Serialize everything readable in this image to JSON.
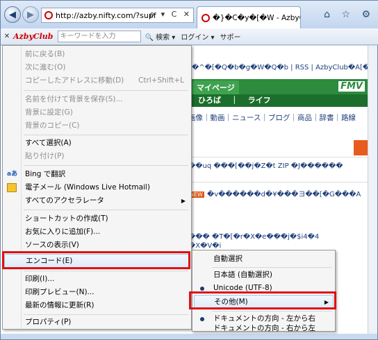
{
  "browser": {
    "url": "http://azby.nifty.com/?supf",
    "url_controls": "ρ ▾ C ✕",
    "tab_title": "�}�C�y�[�W - AzbyClub...",
    "tab_close": "✕",
    "window_controls": "⌂ ☆ ⚙",
    "back": "◀",
    "forward": "▶"
  },
  "toolbar": {
    "close": "✕",
    "brand": "AzbyClub",
    "search_placeholder": "キーワードを入力",
    "search_button": "🔍 検索 ▾",
    "login": "ログイン ▾",
    "support": "サポー"
  },
  "page": {
    "links": "�^�[�Q�b�g�W�Q�b | RSS | AzbyClub�Ȃ[�",
    "mypage_tab": "マイページ",
    "fmv": "FMV",
    "subnav": "ひろば ｜ ライフ",
    "categories": "画像｜動画｜ニュース｜ブログ｜商品｜辞書｜路線",
    "row1": "��uq ���[��j�Z�t ZIP �J������",
    "new_badge": "NEW",
    "row2": "�v������d�¥���ヨ��[�G���A",
    "row3": "��� �T�[�r�X�e���j�$i4�4",
    "row4": "�X�V�i"
  },
  "context_menu": {
    "items": [
      {
        "label": "前に戻る(B)",
        "disabled": true
      },
      {
        "label": "次に進む(O)",
        "disabled": true
      },
      {
        "label": "コピーしたアドレスに移動(D)",
        "shortcut": "Ctrl+Shift+L",
        "disabled": true
      },
      {
        "label": "名前を付けて背景を保存(S)...",
        "disabled": true
      },
      {
        "label": "背景に設定(G)",
        "disabled": true
      },
      {
        "label": "背景のコピー(C)",
        "disabled": true
      },
      {
        "label": "すべて選択(A)",
        "disabled": false
      },
      {
        "label": "貼り付け(P)",
        "disabled": true
      },
      {
        "label": "Bing で翻訳",
        "disabled": false,
        "icon": "translate-icon"
      },
      {
        "label": "電子メール (Windows Live Hotmail)",
        "disabled": false,
        "icon": "email-icon"
      },
      {
        "label": "すべてのアクセラレータ",
        "disabled": false,
        "submenu": true
      },
      {
        "label": "ショートカットの作成(T)",
        "disabled": false
      },
      {
        "label": "お気に入りに追加(F)...",
        "disabled": false
      },
      {
        "label": "ソースの表示(V)",
        "disabled": false
      },
      {
        "label": "エンコード(E)",
        "disabled": false,
        "highlighted": true
      },
      {
        "label": "印刷(I)...",
        "disabled": false
      },
      {
        "label": "印刷プレビュー(N)...",
        "disabled": false
      },
      {
        "label": "最新の情報に更新(R)",
        "disabled": false
      },
      {
        "label": "プロパティ(P)",
        "disabled": false
      }
    ],
    "submenu_arrow": "▶"
  },
  "encode_submenu": {
    "items": [
      {
        "label": "自動選択",
        "checked": false
      },
      {
        "label": "日本語 (自動選択)",
        "checked": false
      },
      {
        "label": "Unicode (UTF-8)",
        "checked": true
      },
      {
        "label": "その他(M)",
        "submenu": true,
        "highlighted": true
      },
      {
        "label": "ドキュメントの方向 - 左から右",
        "checked": true
      },
      {
        "label": "ドキュメントの方向 - 右から左",
        "checked": false
      }
    ]
  },
  "colors": {
    "highlight_border": "#e01010",
    "site_green": "#2c8b3d"
  }
}
